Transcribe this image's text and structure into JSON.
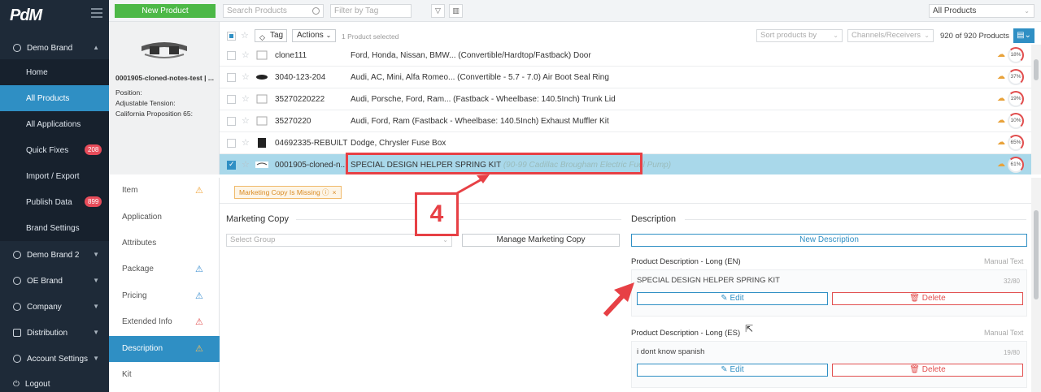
{
  "sidebar": {
    "logo": "PdM",
    "brands": [
      {
        "label": "Demo Brand",
        "expanded": true
      },
      {
        "label": "Demo Brand 2"
      },
      {
        "label": "OE Brand"
      },
      {
        "label": "Company"
      },
      {
        "label": "Distribution"
      },
      {
        "label": "Account Settings"
      }
    ],
    "sub_items": [
      {
        "label": "Home"
      },
      {
        "label": "All Products",
        "active": true
      },
      {
        "label": "All Applications"
      },
      {
        "label": "Quick Fixes",
        "badge": "208"
      },
      {
        "label": "Import / Export"
      },
      {
        "label": "Publish Data",
        "badge": "899"
      },
      {
        "label": "Brand Settings"
      }
    ],
    "logout": "Logout"
  },
  "topbar": {
    "new_product": "New Product",
    "search_placeholder": "Search Products",
    "filter_placeholder": "Filter by Tag",
    "scope": "All Products"
  },
  "preview": {
    "title": "0001905-cloned-notes-test | ...",
    "attrs": [
      "Position:",
      "Adjustable Tension:",
      "California Proposition 65:"
    ]
  },
  "list_toolbar": {
    "tag": "Tag",
    "actions": "Actions",
    "selected": "1 Product selected",
    "sort_placeholder": "Sort products by",
    "channels_placeholder": "Channels/Receivers",
    "count": "920 of 920 Products"
  },
  "products": [
    {
      "sku": "clone111",
      "desc": "Ford, Honda, Nissan, BMW... (Convertible/Hardtop/Fastback) Door",
      "pct": "18%"
    },
    {
      "sku": "3040-123-204",
      "desc": "Audi, AC, Mini, Alfa Romeo... (Convertible - 5.7 - 7.0) Air Boot Seal Ring",
      "pct": "37%"
    },
    {
      "sku": "35270220222",
      "desc": "Audi, Porsche, Ford, Ram... (Fastback - Wheelbase: 140.5Inch) Trunk Lid",
      "pct": "19%"
    },
    {
      "sku": "35270220",
      "desc": "Audi, Ford, Ram (Fastback - Wheelbase: 140.5Inch) Exhaust Muffler Kit",
      "pct": "10%"
    },
    {
      "sku": "04692335-REBUILT",
      "desc": "Dodge, Chrysler Fuse Box",
      "pct": "65%"
    },
    {
      "sku": "0001905-cloned-n...",
      "desc": "SPECIAL DESIGN HELPER SPRING KIT",
      "desc_sub": "(90-99 Cadillac Brougham Electric Fuel Pump)",
      "pct": "61%",
      "selected": true
    }
  ],
  "tabs": [
    {
      "label": "Item",
      "warn": "orange"
    },
    {
      "label": "Application"
    },
    {
      "label": "Attributes"
    },
    {
      "label": "Package",
      "warn": "blue"
    },
    {
      "label": "Pricing",
      "warn": "blue"
    },
    {
      "label": "Extended Info",
      "warn": "red"
    },
    {
      "label": "Description",
      "warn": "orange",
      "active": true
    },
    {
      "label": "Kit"
    }
  ],
  "detail": {
    "missing_tag": "Marketing Copy Is Missing",
    "marketing_title": "Marketing Copy",
    "select_group_placeholder": "Select Group",
    "manage_copy": "Manage Marketing Copy",
    "description_title": "Description",
    "new_description": "New Description",
    "descriptions": [
      {
        "label": "Product Description - Long (EN)",
        "type": "Manual Text",
        "text": "SPECIAL DESIGN HELPER SPRING KIT",
        "count": "32/80"
      },
      {
        "label": "Product Description - Long (ES)",
        "type": "Manual Text",
        "text": "i dont know spanish",
        "count": "19/80"
      }
    ],
    "edit": "Edit",
    "delete": "Delete"
  },
  "annotation": {
    "step": "4"
  },
  "colors": {
    "sidebar": "#1e2a38",
    "accent": "#2f8fc4",
    "green": "#4cb847",
    "annotation_red": "#e74045"
  }
}
